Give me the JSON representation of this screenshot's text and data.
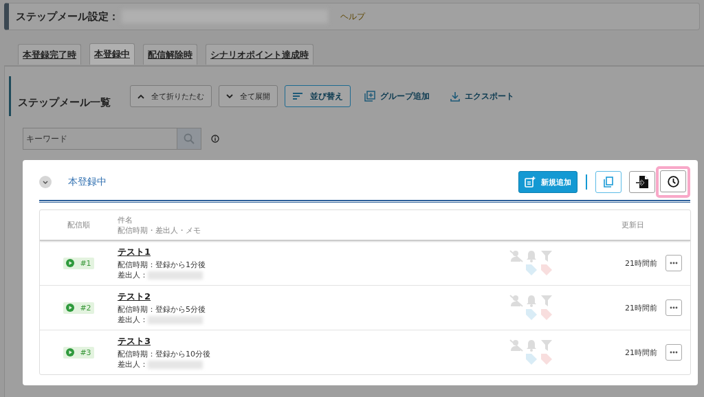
{
  "header": {
    "title": "ステップメール設定：",
    "help": "ヘルプ"
  },
  "tabs": [
    {
      "label": "本登録完了時",
      "selected": false
    },
    {
      "label": "本登録中",
      "selected": true
    },
    {
      "label": "配信解除時",
      "selected": false
    },
    {
      "label": "シナリオポイント達成時",
      "selected": false
    }
  ],
  "list": {
    "title": "ステップメール一覧",
    "buttons": [
      {
        "kind": "collapse",
        "label": "全て折りたたむ"
      },
      {
        "kind": "expand",
        "label": "全て展開"
      },
      {
        "kind": "sort",
        "label": "並び替え"
      },
      {
        "kind": "group",
        "label": "グループ追加"
      },
      {
        "kind": "export",
        "label": "エクスポート"
      }
    ],
    "search": {
      "placeholder": "キーワード"
    }
  },
  "group": {
    "title": "本登録中",
    "add_button": "新規追加",
    "columns": {
      "order": "配信順",
      "subject": "件名",
      "subject_sub": "配信時期・差出人・メモ",
      "updated": "更新日"
    },
    "rows": [
      {
        "order": "#1",
        "subject": "テスト1",
        "timing": "配信時期：登録から1分後",
        "sender": "差出人：",
        "updated": "21時間前"
      },
      {
        "order": "#2",
        "subject": "テスト2",
        "timing": "配信時期：登録から5分後",
        "sender": "差出人：",
        "updated": "21時間前"
      },
      {
        "order": "#3",
        "subject": "テスト3",
        "timing": "配信時期：登録から10分後",
        "sender": "差出人：",
        "updated": "21時間前"
      }
    ]
  }
}
